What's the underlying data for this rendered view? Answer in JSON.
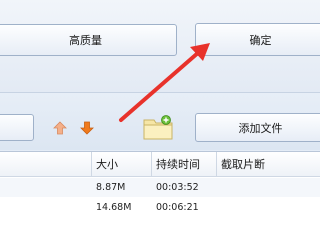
{
  "buttons": {
    "quality_label": "高质量",
    "confirm_label": "确定",
    "add_file_label": "添加文件",
    "left_partial_label": ""
  },
  "icons": {
    "move_up": "arrow-up-icon",
    "move_down": "arrow-down-icon",
    "add_folder": "folder-add-icon",
    "annotation": "red-arrow-annotation"
  },
  "colors": {
    "annotation_red": "#e8322b",
    "up_arrow": "#f4b08a",
    "down_arrow": "#f07a1c",
    "folder": "#f6e6a6"
  },
  "table": {
    "columns": [
      "大小",
      "持续时间",
      "截取片断"
    ],
    "rows": [
      {
        "size": "8.87M",
        "duration": "00:03:52",
        "clip": ""
      },
      {
        "size": "14.68M",
        "duration": "00:06:21",
        "clip": ""
      }
    ]
  }
}
